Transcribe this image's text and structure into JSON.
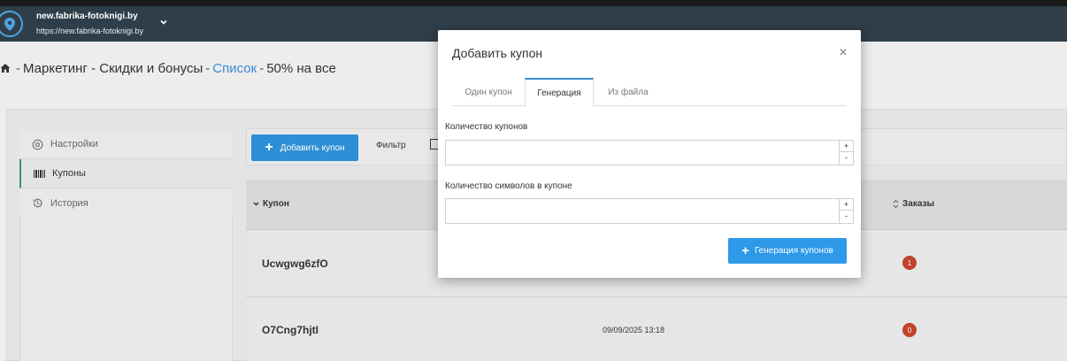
{
  "site": {
    "name": "new.fabrika-fotoknigi.by",
    "url": "https://new.fabrika-fotoknigi.by"
  },
  "breadcrumb": {
    "part1": "Маркетинг - Скидки и бонусы",
    "sep1": "-",
    "sep0": "-",
    "link": "Список",
    "sep2": "-",
    "part3": "50% на все"
  },
  "sidebar": {
    "items": [
      {
        "label": "Настройки",
        "icon": "gear-icon"
      },
      {
        "label": "Купоны",
        "icon": "barcode-icon"
      },
      {
        "label": "История",
        "icon": "history-icon"
      }
    ]
  },
  "toolbar": {
    "add_label": "Добавить купон",
    "filter_label": "Фильтр"
  },
  "table": {
    "col_coupon": "Купон",
    "col_orders": "Заказы",
    "rows": [
      {
        "code": "Ucwgwg6zfO",
        "date": "",
        "orders": "1"
      },
      {
        "code": "O7Cng7hjtI",
        "date": "09/09/2025 13:18",
        "orders": "0"
      }
    ]
  },
  "modal": {
    "title": "Добавить купон",
    "close": "×",
    "tabs": [
      "Один купон",
      "Генерация",
      "Из файла"
    ],
    "active_tab": "Генерация",
    "field1_label": "Количество купонов",
    "field2_label": "Количество символов в купоне",
    "spin_up": "+",
    "spin_down": "-",
    "generate_label": "Генерация купонов"
  },
  "colors": {
    "topbar": "#2f3e49",
    "accent": "#2d8fd5",
    "badge": "#c0432a"
  }
}
